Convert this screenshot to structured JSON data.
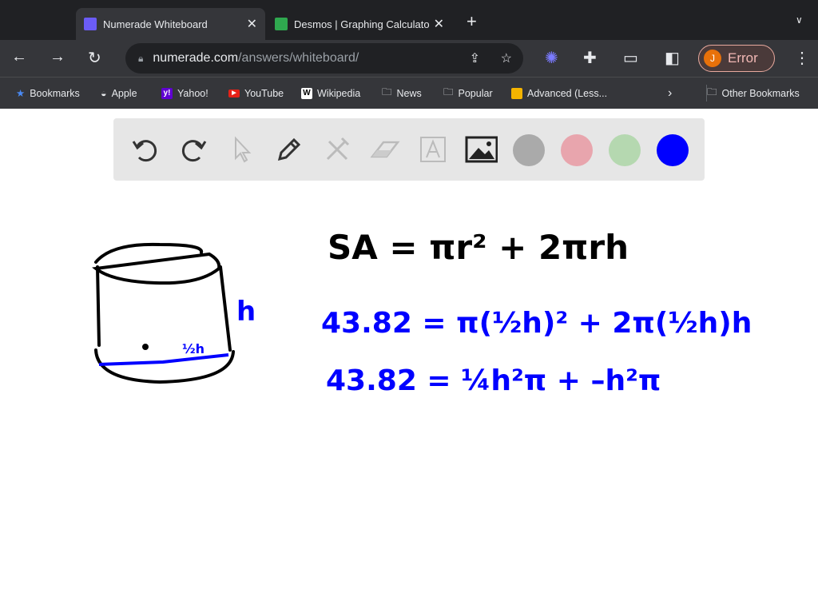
{
  "tabs": [
    {
      "title": "Numerade Whiteboard",
      "active": true
    },
    {
      "title": "Desmos | Graphing Calculato",
      "active": false
    }
  ],
  "address": {
    "domain": "numerade.com",
    "path": "/answers/whiteboard/"
  },
  "profile": {
    "initial": "J",
    "status": "Error"
  },
  "bookmarks": [
    {
      "label": "Bookmarks",
      "icon": "star-icon"
    },
    {
      "label": "Apple",
      "icon": "apple-icon"
    },
    {
      "label": "Yahoo!",
      "icon": "yahoo-icon"
    },
    {
      "label": "YouTube",
      "icon": "youtube-icon"
    },
    {
      "label": "Wikipedia",
      "icon": "wikipedia-icon"
    },
    {
      "label": "News",
      "icon": "folder-icon"
    },
    {
      "label": "Popular",
      "icon": "folder-icon"
    },
    {
      "label": "Advanced (Less...",
      "icon": "slides-icon"
    }
  ],
  "other_bookmarks": "Other Bookmarks",
  "whiteboard": {
    "colors": [
      "#aaaaaa",
      "#e8a5ad",
      "#b5d8b0",
      "#0000ff"
    ],
    "selected_color": "#0000ff",
    "equations": [
      "SA = πr² + 2πrh",
      "43.82 = π(½h)² + 2π(½h)h",
      "43.82 = ¼h²π + –h²π"
    ],
    "labels": {
      "height": "h",
      "radius": "½h"
    }
  }
}
